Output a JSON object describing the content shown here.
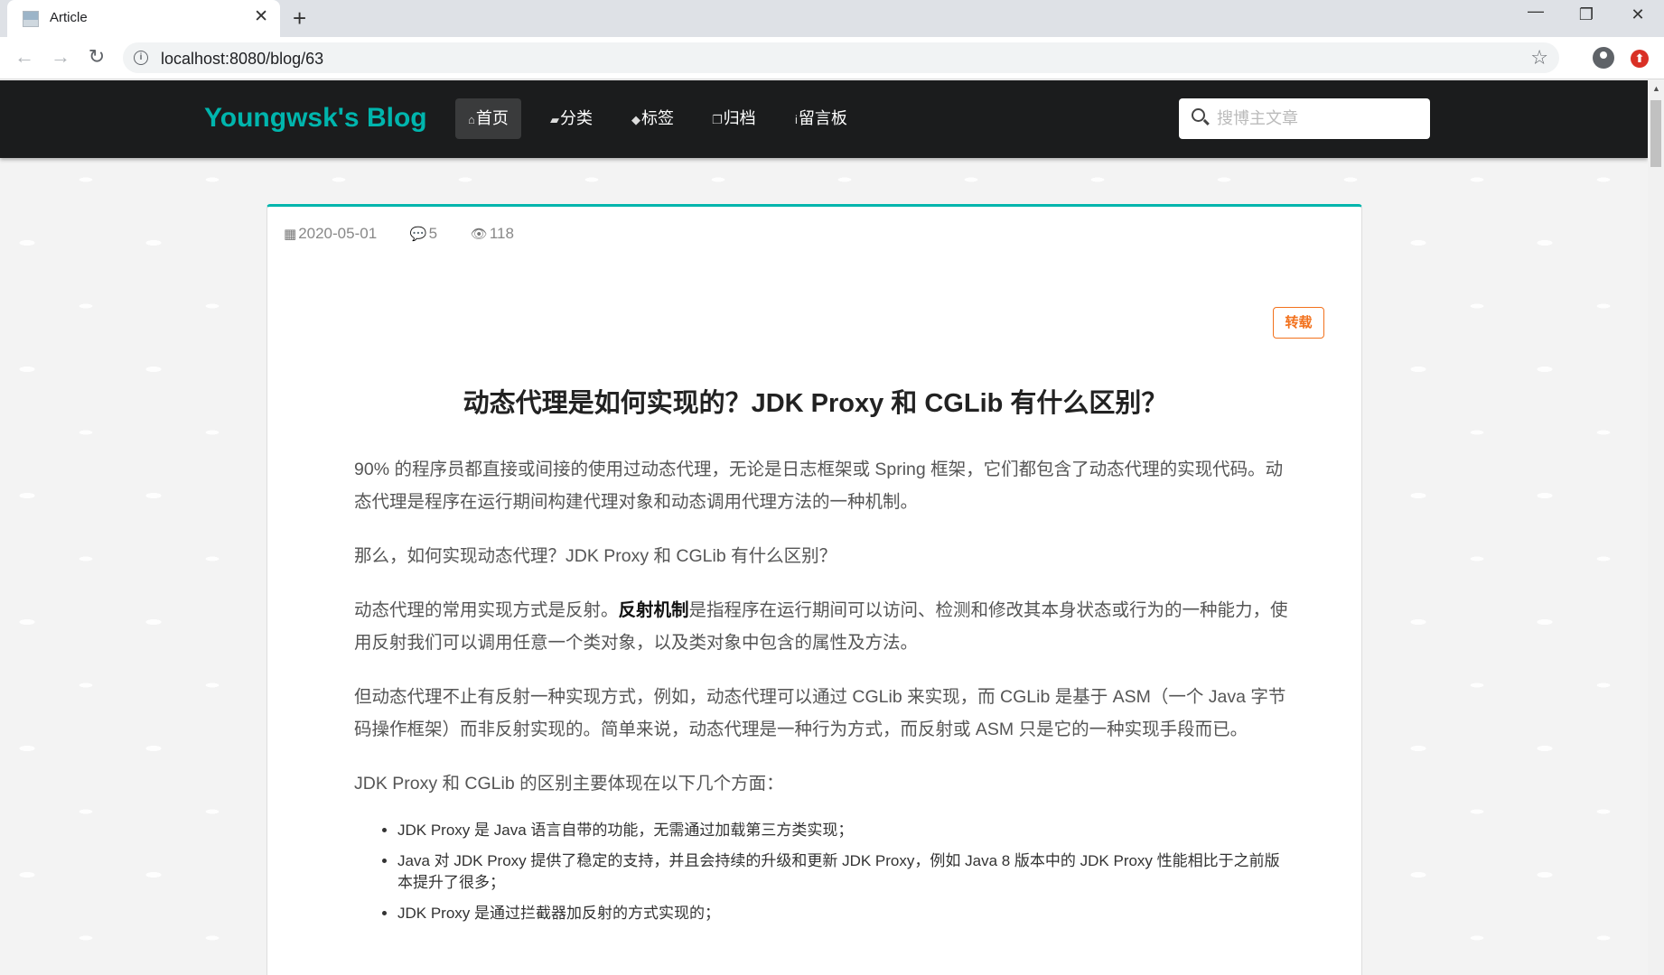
{
  "browser": {
    "tab_title": "Article",
    "new_tab": "+",
    "tab_close": "✕",
    "url": "localhost:8080/blog/63",
    "window_controls": {
      "minimize": "—",
      "maximize": "❐",
      "close": "✕"
    },
    "nav": {
      "back": "←",
      "forward": "→",
      "reload": "↻",
      "star": "☆",
      "info": "i"
    }
  },
  "site": {
    "brand": "Youngwsk's Blog",
    "nav": [
      {
        "icon": "home-icon",
        "glyph": "⌂",
        "label": "首页"
      },
      {
        "icon": "folder-icon",
        "glyph": "▰",
        "label": "分类"
      },
      {
        "icon": "tags-icon",
        "glyph": "◆",
        "label": "标签"
      },
      {
        "icon": "clone-icon",
        "glyph": "❐",
        "label": "归档"
      },
      {
        "icon": "info-icon",
        "glyph": "i",
        "label": "留言板"
      }
    ],
    "search_placeholder": "搜博主文章"
  },
  "article": {
    "date": "2020-05-01",
    "comments": "5",
    "views": "118",
    "tag": "转载",
    "title": "动态代理是如何实现的？JDK Proxy 和 CGLib 有什么区别？",
    "p1": "90% 的程序员都直接或间接的使用过动态代理，无论是日志框架或 Spring 框架，它们都包含了动态代理的实现代码。动态代理是程序在运行期间构建代理对象和动态调用代理方法的一种机制。",
    "p2": "那么，如何实现动态代理？JDK Proxy 和 CGLib 有什么区别？",
    "p3_pre": "动态代理的常用实现方式是反射。",
    "p3_bold": "反射机制",
    "p3_post": "是指程序在运行期间可以访问、检测和修改其本身状态或行为的一种能力，使用反射我们可以调用任意一个类对象，以及类对象中包含的属性及方法。",
    "p4": "但动态代理不止有反射一种实现方式，例如，动态代理可以通过 CGLib 来实现，而 CGLib 是基于 ASM（一个 Java 字节码操作框架）而非反射实现的。简单来说，动态代理是一种行为方式，而反射或 ASM 只是它的一种实现手段而已。",
    "p5": "JDK Proxy 和 CGLib 的区别主要体现在以下几个方面：",
    "list": [
      "JDK Proxy 是 Java 语言自带的功能，无需通过加载第三方类实现；",
      "Java 对 JDK Proxy 提供了稳定的支持，并且会持续的升级和更新 JDK Proxy，例如 Java 8 版本中的 JDK Proxy 性能相比于之前版本提升了很多；",
      "JDK Proxy 是通过拦截器加反射的方式实现的；"
    ]
  }
}
